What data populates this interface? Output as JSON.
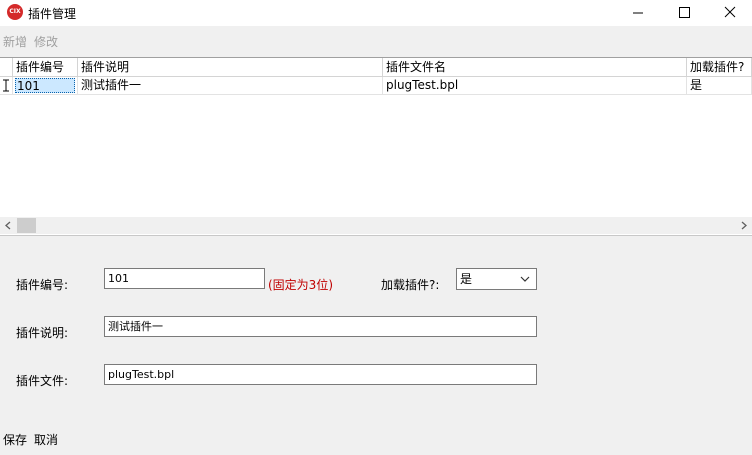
{
  "window": {
    "title": "插件管理",
    "icon_text": "CIX",
    "icons": [
      "minimize-icon",
      "maximize-icon",
      "close-icon"
    ]
  },
  "toolbar": {
    "add_label": "新增",
    "edit_label": "修改"
  },
  "grid": {
    "columns": [
      "插件编号",
      "插件说明",
      "插件文件名",
      "加载插件?"
    ],
    "rows": [
      [
        "101",
        "测试插件一",
        "plugTest.bpl",
        "是"
      ]
    ],
    "current_row_marker": "I"
  },
  "form": {
    "plugin_no_label": "插件编号:",
    "plugin_no_value": "101",
    "plugin_no_hint": "(固定为3位)",
    "load_label": "加载插件?:",
    "load_value": "是",
    "desc_label": "插件说明:",
    "desc_value": "测试插件一",
    "file_label": "插件文件:",
    "file_value": "plugTest.bpl"
  },
  "footer": {
    "save_label": "保存",
    "cancel_label": "取消"
  },
  "colors": {
    "hint": "#c00000",
    "selection": "#cce8ff",
    "app_icon": "#d42a2a"
  }
}
